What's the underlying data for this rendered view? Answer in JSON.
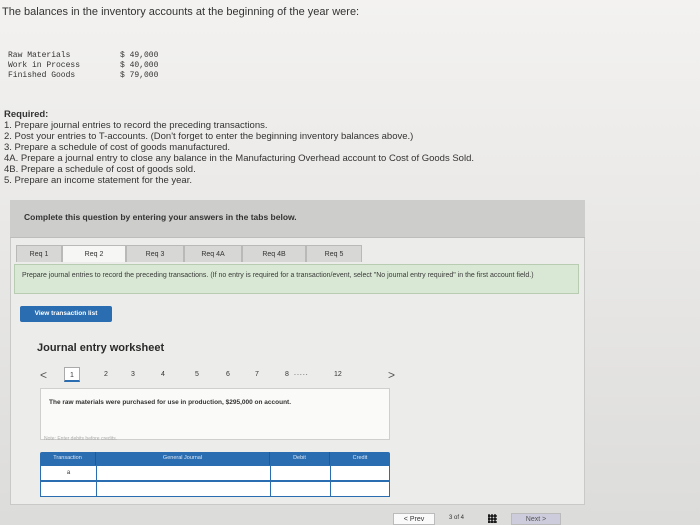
{
  "intro_text": "The balances in the inventory accounts at the beginning of the year were:",
  "balances": [
    {
      "label": "Raw Materials",
      "value": "$ 49,000"
    },
    {
      "label": "Work in Process",
      "value": "$ 40,000"
    },
    {
      "label": "Finished Goods",
      "value": "$ 79,000"
    }
  ],
  "required": {
    "heading": "Required:",
    "items": [
      "1. Prepare journal entries to record the preceding transactions.",
      "2. Post your entries to T-accounts. (Don't forget to enter the beginning inventory balances above.)",
      "3. Prepare a schedule of cost of goods manufactured.",
      "4A. Prepare a journal entry to close any balance in the Manufacturing Overhead account to Cost of Goods Sold.",
      "4B. Prepare a schedule of cost of goods sold.",
      "5. Prepare an income statement for the year."
    ]
  },
  "complete_text": "Complete this question by entering your answers in the tabs below.",
  "tabs": [
    "Req 1",
    "Req 2",
    "Req 3",
    "Req 4A",
    "Req 4B",
    "Req 5"
  ],
  "instruction": "Prepare journal entries to record the preceding transactions. (If no entry is required for a transaction/event, select \"No journal entry required\" in the first account field.)",
  "view_button": "View transaction list",
  "worksheet_title": "Journal entry worksheet",
  "pager": {
    "prev": "<",
    "pages": [
      "1",
      "2",
      "3",
      "4",
      "5",
      "6",
      "7",
      "8"
    ],
    "dots": ".....",
    "last": "12",
    "next": ">"
  },
  "transaction_text": "The raw materials were purchased for use in production, $295,000 on account.",
  "note": "Note: Enter debits before credits.",
  "table_headers": [
    "Transaction",
    "General Journal",
    "Debit",
    "Credit"
  ],
  "table_rows": [
    {
      "transaction": "a",
      "account": "",
      "debit": "",
      "credit": ""
    },
    {
      "transaction": "",
      "account": "",
      "debit": "",
      "credit": ""
    }
  ],
  "bottom_nav": {
    "prev": "< Prev",
    "count": "3 of 4",
    "next": "Next >"
  },
  "colors": {
    "accent": "#2a6db1",
    "instruction_bg": "#d9e8d4"
  }
}
